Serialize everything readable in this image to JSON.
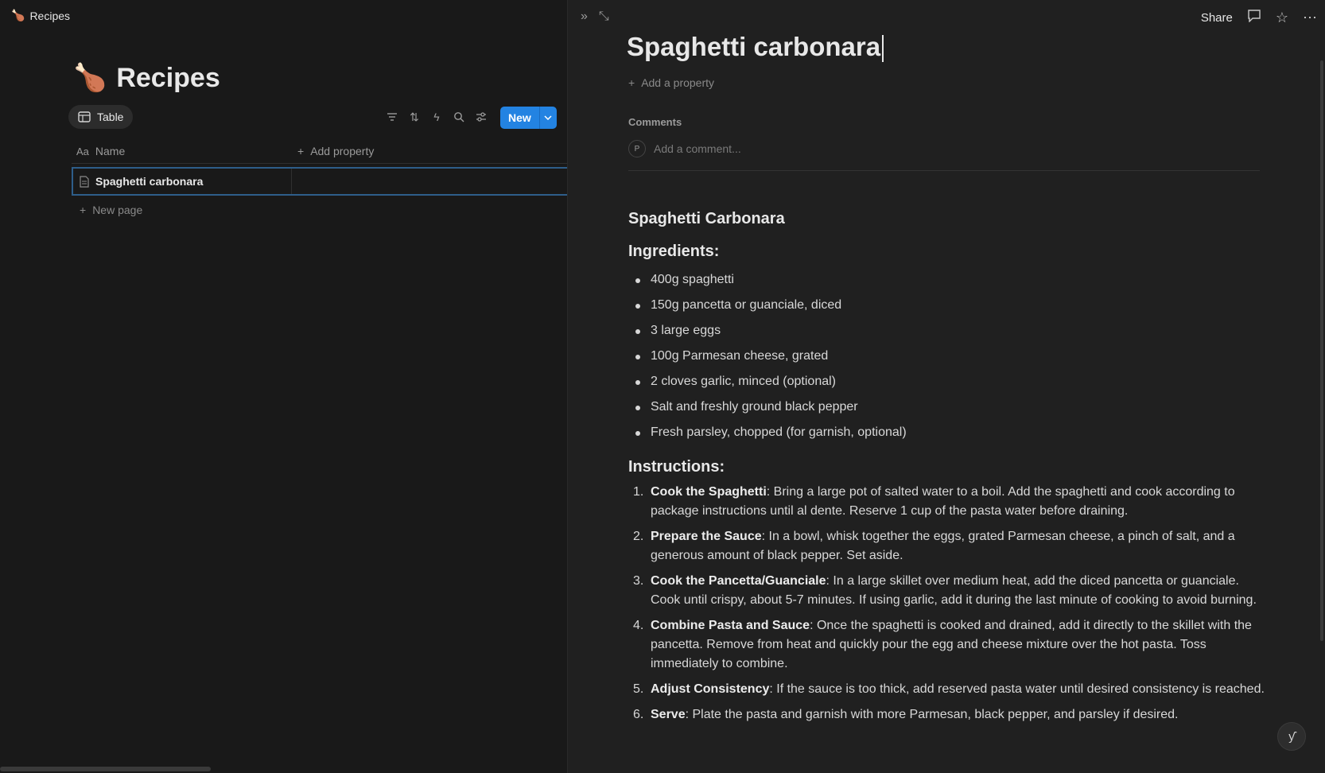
{
  "breadcrumb": {
    "emoji": "🍗",
    "label": "Recipes"
  },
  "database": {
    "emoji": "🍗",
    "title": "Recipes",
    "view_tab": "Table",
    "new_label": "New",
    "columns": {
      "name": "Name",
      "add_property": "Add property"
    },
    "rows": [
      {
        "name": "Spaghetti carbonara"
      }
    ],
    "new_page": "New page"
  },
  "peek": {
    "share": "Share",
    "title": "Spaghetti carbonara",
    "add_property": "Add a property",
    "comments_label": "Comments",
    "avatar_initial": "P",
    "comment_placeholder": "Add a comment...",
    "heading": "Spaghetti Carbonara",
    "ingredients_heading": "Ingredients:",
    "ingredients": [
      "400g spaghetti",
      "150g pancetta or guanciale, diced",
      "3 large eggs",
      "100g Parmesan cheese, grated",
      "2 cloves garlic, minced (optional)",
      "Salt and freshly ground black pepper",
      "Fresh parsley, chopped (for garnish, optional)"
    ],
    "instructions_heading": "Instructions:",
    "steps": [
      {
        "num": "1.",
        "title": "Cook the Spaghetti",
        "text": ": Bring a large pot of salted water to a boil. Add the spaghetti and cook according to package instructions until al dente. Reserve 1 cup of the pasta water before draining."
      },
      {
        "num": "2.",
        "title": "Prepare the Sauce",
        "text": ": In a bowl, whisk together the eggs, grated Parmesan cheese, a pinch of salt, and a generous amount of black pepper. Set aside."
      },
      {
        "num": "3.",
        "title": "Cook the Pancetta/Guanciale",
        "text": ": In a large skillet over medium heat, add the diced pancetta or guanciale. Cook until crispy, about 5-7 minutes. If using garlic, add it during the last minute of cooking to avoid burning."
      },
      {
        "num": "4.",
        "title": "Combine Pasta and Sauce",
        "text": ": Once the spaghetti is cooked and drained, add it directly to the skillet with the pancetta. Remove from heat and quickly pour the egg and cheese mixture over the hot pasta. Toss immediately to combine."
      },
      {
        "num": "5.",
        "title": "Adjust Consistency",
        "text": ": If the sauce is too thick, add reserved pasta water until desired consistency is reached."
      },
      {
        "num": "6.",
        "title": "Serve",
        "text": ": Plate the pasta and garnish with more Parmesan, black pepper, and parsley if desired."
      }
    ]
  }
}
